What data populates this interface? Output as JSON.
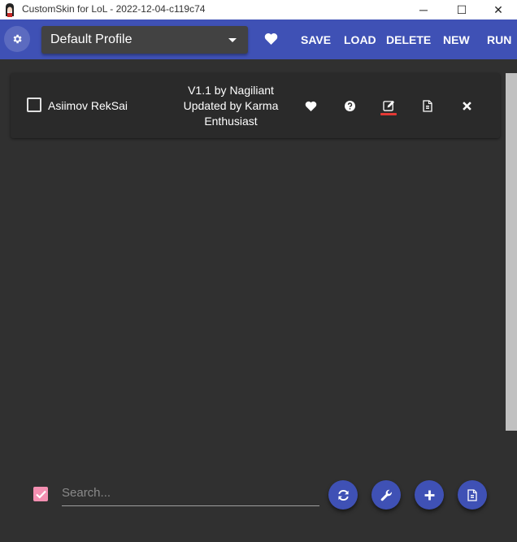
{
  "window": {
    "title": "CustomSkin for LoL - 2022-12-04-c119c74",
    "app_icon": "anime-girl-avatar-icon",
    "minimize_glyph": "─",
    "maximize_glyph": "☐",
    "close_glyph": "✕"
  },
  "header": {
    "settings_icon": "gear-icon",
    "profile": {
      "selected": "Default Profile"
    },
    "favorite_icon": "heart-icon",
    "buttons": {
      "save": "SAVE",
      "load": "LOAD",
      "delete": "DELETE",
      "new": "NEW",
      "run": "RUN"
    },
    "accent_color": "#3f51b5"
  },
  "mods": [
    {
      "name": "Asiimov RekSai",
      "info_lines": [
        "V1.1 by Nagiliant",
        "Updated by Karma",
        "Enthusiast"
      ],
      "enabled": false,
      "actions": [
        "heart-icon",
        "help-icon",
        "edit-icon",
        "file-icon",
        "close-icon"
      ]
    }
  ],
  "footer": {
    "select_all_checked": true,
    "search": {
      "placeholder": "Search...",
      "value": ""
    },
    "fabs": [
      "refresh-icon",
      "wrench-icon",
      "add-icon",
      "import-file-icon"
    ]
  },
  "colors": {
    "background": "#303030",
    "card": "#2a2a2a",
    "edit_indicator": "#e53935",
    "checkbox_pink": "#f48fb1"
  }
}
